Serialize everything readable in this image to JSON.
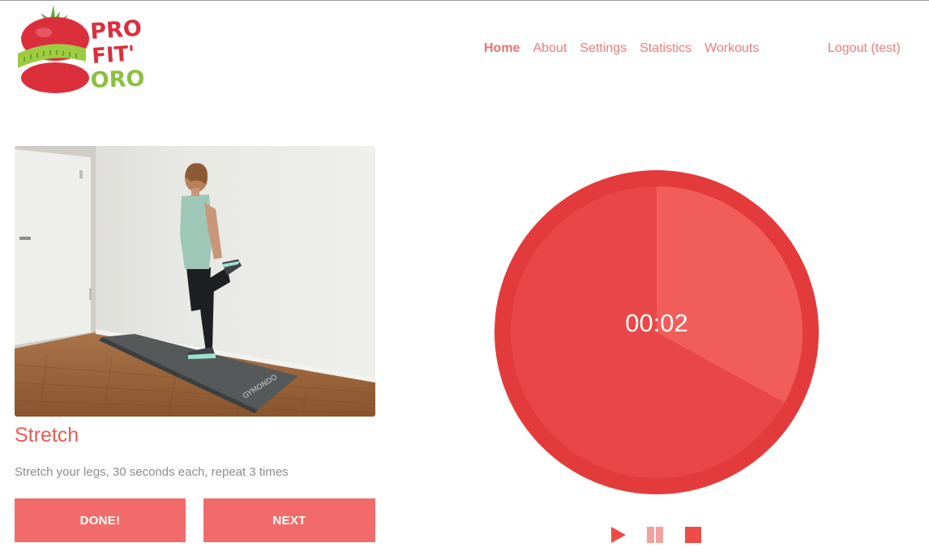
{
  "brand": {
    "line1": "PRO",
    "line2": "FIT'",
    "line3": "ORO"
  },
  "nav": {
    "items": [
      {
        "label": "Home",
        "active": true
      },
      {
        "label": "About"
      },
      {
        "label": "Settings"
      },
      {
        "label": "Statistics"
      },
      {
        "label": "Workouts"
      }
    ],
    "logout": "Logout (test)"
  },
  "exercise": {
    "title": "Stretch",
    "description": "Stretch your legs, 30 seconds each, repeat 3 times",
    "mat_brand": "GYMONDO"
  },
  "buttons": {
    "done": "DONE!",
    "next": "NEXT"
  },
  "timer": {
    "display": "00:02",
    "elapsed_fraction": 0.33
  },
  "controls": {
    "play": "play-icon",
    "pause": "pause-icon",
    "stop": "stop-icon"
  },
  "colors": {
    "accent": "#f26b6b",
    "timer_outer": "#e33b3b",
    "timer_inner": "#e94747",
    "timer_elapsed": "#f15e5a",
    "logo_red": "#dc2f3c",
    "logo_green": "#8cbf3f"
  }
}
